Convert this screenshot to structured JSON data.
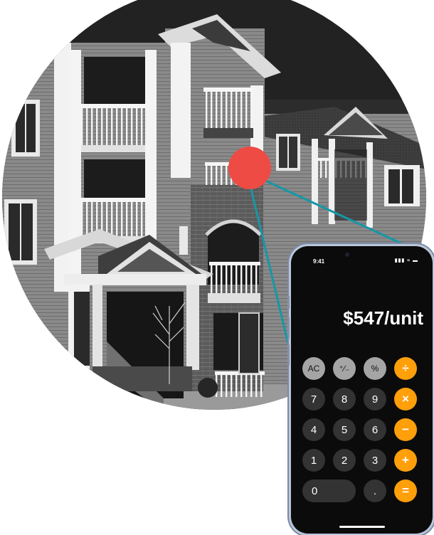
{
  "colors": {
    "marker": "#ee4b45",
    "connector": "#1797a6",
    "phone_frame": "#b9c6da",
    "function_key": "#a5a5a5",
    "number_key": "#333333",
    "operator_key": "#ff9f0a"
  },
  "phone": {
    "status_time": "9:41",
    "status_icons": "▮▮▮ ≈ ▬",
    "display_value": "$547/unit",
    "keys": [
      {
        "label": "AC",
        "kind": "fn",
        "name": "key-ac"
      },
      {
        "label": "⁺∕₋",
        "kind": "fn",
        "name": "key-plus-minus"
      },
      {
        "label": "%",
        "kind": "fn",
        "name": "key-percent"
      },
      {
        "label": "÷",
        "kind": "op",
        "name": "key-divide"
      },
      {
        "label": "7",
        "kind": "num",
        "name": "key-7"
      },
      {
        "label": "8",
        "kind": "num",
        "name": "key-8"
      },
      {
        "label": "9",
        "kind": "num",
        "name": "key-9"
      },
      {
        "label": "×",
        "kind": "op",
        "name": "key-multiply"
      },
      {
        "label": "4",
        "kind": "num",
        "name": "key-4"
      },
      {
        "label": "5",
        "kind": "num",
        "name": "key-5"
      },
      {
        "label": "6",
        "kind": "num",
        "name": "key-6"
      },
      {
        "label": "−",
        "kind": "op",
        "name": "key-subtract"
      },
      {
        "label": "1",
        "kind": "num",
        "name": "key-1"
      },
      {
        "label": "2",
        "kind": "num",
        "name": "key-2"
      },
      {
        "label": "3",
        "kind": "num",
        "name": "key-3"
      },
      {
        "label": "+",
        "kind": "op",
        "name": "key-add"
      },
      {
        "label": "0",
        "kind": "num",
        "name": "key-0",
        "wide": true
      },
      {
        "label": ".",
        "kind": "num",
        "name": "key-decimal"
      },
      {
        "label": "=",
        "kind": "op",
        "name": "key-equals"
      }
    ]
  }
}
